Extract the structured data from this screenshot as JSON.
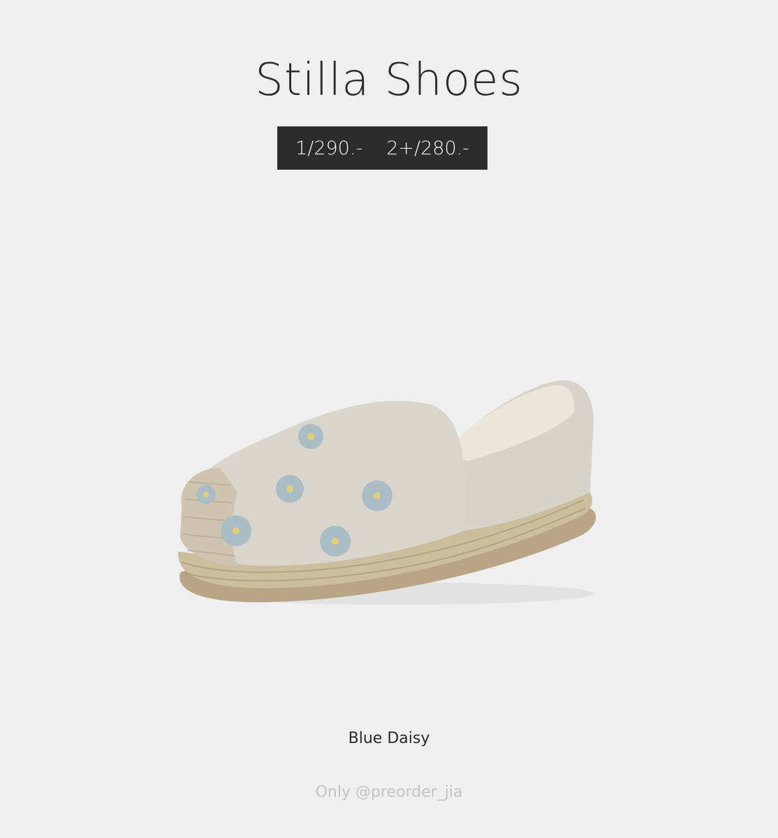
{
  "title": "Stilla Shoes",
  "prices": {
    "single": "1/290.-",
    "multi": "2+/280.-"
  },
  "product_image": {
    "icon": "espadrille-shoe-image",
    "upper_color": "#d6d2c9",
    "flower_color": "#a9bcc4",
    "flower_center_color": "#e2cf7a",
    "jute_color": "#c9b99c",
    "sole_color": "#b49f82"
  },
  "variant_name": "Blue Daisy",
  "watermark": "Only @preorder_jia"
}
